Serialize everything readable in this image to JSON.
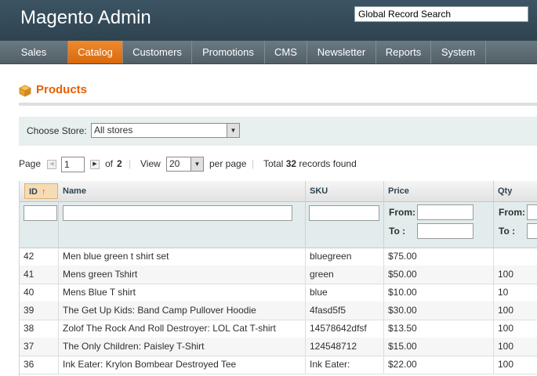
{
  "header": {
    "title": "Magento Admin",
    "search_value": "Global Record Search"
  },
  "nav": {
    "items": [
      {
        "label": "Sales",
        "active": false
      },
      {
        "label": "Catalog",
        "active": true
      },
      {
        "label": "Customers",
        "active": false
      },
      {
        "label": "Promotions",
        "active": false
      },
      {
        "label": "CMS",
        "active": false
      },
      {
        "label": "Newsletter",
        "active": false
      },
      {
        "label": "Reports",
        "active": false
      },
      {
        "label": "System",
        "active": false
      }
    ]
  },
  "page": {
    "title": "Products",
    "icon": "box-icon"
  },
  "store": {
    "label": "Choose Store:",
    "selected": "All stores"
  },
  "pager": {
    "page_label": "Page",
    "page_value": "1",
    "of_label": "of",
    "total_pages": "2",
    "view_label": "View",
    "view_value": "20",
    "per_page_label": "per page",
    "total_prefix": "Total",
    "total_count": "32",
    "total_suffix": "records found"
  },
  "grid": {
    "columns": [
      "ID",
      "Name",
      "SKU",
      "Price",
      "Qty"
    ],
    "filter_labels": {
      "from": "From:",
      "to": "To :"
    },
    "rows": [
      {
        "id": "42",
        "name": "Men blue green t shirt set",
        "sku": "bluegreen",
        "price": "$75.00",
        "qty": ""
      },
      {
        "id": "41",
        "name": "Mens green Tshirt",
        "sku": "green",
        "price": "$50.00",
        "qty": "100"
      },
      {
        "id": "40",
        "name": "Mens Blue T shirt",
        "sku": "blue",
        "price": "$10.00",
        "qty": "10"
      },
      {
        "id": "39",
        "name": "The Get Up Kids: Band Camp Pullover Hoodie",
        "sku": "4fasd5f5",
        "price": "$30.00",
        "qty": "100"
      },
      {
        "id": "38",
        "name": "Zolof The Rock And Roll Destroyer: LOL Cat T-shirt",
        "sku": "14578642dfsf",
        "price": "$13.50",
        "qty": "100"
      },
      {
        "id": "37",
        "name": "The Only Children: Paisley T-Shirt",
        "sku": "124548712",
        "price": "$15.00",
        "qty": "100"
      },
      {
        "id": "36",
        "name": "Ink Eater: Krylon Bombear Destroyed Tee",
        "sku": "Ink Eater:",
        "price": "$22.00",
        "qty": "100"
      }
    ]
  },
  "colors": {
    "accent": "#eb5e00",
    "header": "#2e4350",
    "nav_active": "#e07418"
  }
}
